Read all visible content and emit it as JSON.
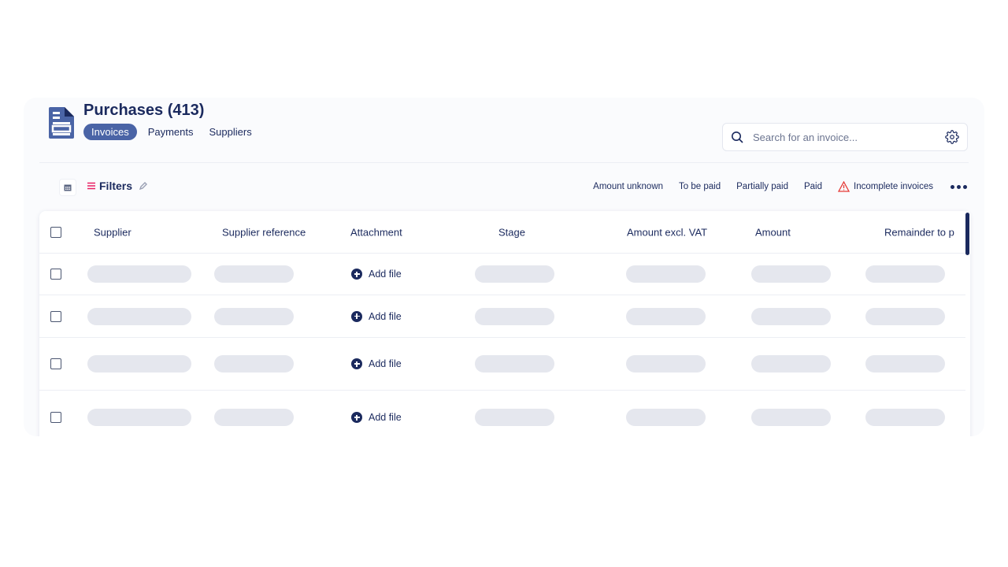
{
  "header": {
    "title": "Purchases (413)",
    "tabs": [
      {
        "label": "Invoices",
        "active": true
      },
      {
        "label": "Payments",
        "active": false
      },
      {
        "label": "Suppliers",
        "active": false
      }
    ]
  },
  "search": {
    "placeholder": "Search for an invoice..."
  },
  "filters": {
    "label": "Filters"
  },
  "status_tabs": [
    {
      "label": "Amount unknown"
    },
    {
      "label": "To be paid"
    },
    {
      "label": "Partially paid"
    },
    {
      "label": "Paid"
    },
    {
      "label": "Incomplete invoices",
      "icon": "warning-icon"
    }
  ],
  "table": {
    "columns": [
      "Supplier",
      "Supplier reference",
      "Attachment",
      "Stage",
      "Amount excl. VAT",
      "Amount",
      "Remainder to p"
    ],
    "rows": [
      {
        "attachment": "Add file"
      },
      {
        "attachment": "Add file"
      },
      {
        "attachment": "Add file"
      },
      {
        "attachment": "Add file"
      }
    ]
  },
  "colors": {
    "brand": "#1b2a5e",
    "accent": "#4a64a6",
    "warning": "#e53935",
    "filter_icon": "#e91e63"
  }
}
